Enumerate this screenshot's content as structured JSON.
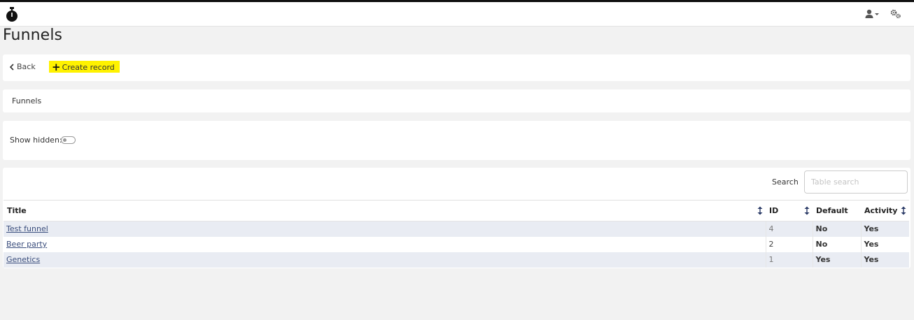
{
  "header": {
    "logo_icon": "stopwatch-icon",
    "user_icon": "user-dropdown-icon",
    "settings_icon": "gears-icon"
  },
  "page": {
    "title": "Funnels"
  },
  "toolbar": {
    "back_label": "Back",
    "create_label": "Create record",
    "create_highlight_color": "#fff200"
  },
  "breadcrumb": {
    "label": "Funnels"
  },
  "filters": {
    "show_hidden_label": "Show hidden:",
    "show_hidden": false
  },
  "search": {
    "label": "Search",
    "placeholder": "Table search",
    "value": ""
  },
  "table": {
    "columns": [
      {
        "label": "Title"
      },
      {
        "label": "ID"
      },
      {
        "label": "Default"
      },
      {
        "label": "Activity"
      }
    ],
    "rows": [
      {
        "title": "Test funnel",
        "id": "4",
        "default": "No",
        "activity": "Yes"
      },
      {
        "title": "Beer party",
        "id": "2",
        "default": "No",
        "activity": "Yes"
      },
      {
        "title": "Genetics",
        "id": "1",
        "default": "Yes",
        "activity": "Yes"
      }
    ]
  },
  "colors": {
    "yes": "#197a3e",
    "no": "#d02020",
    "link": "#3a4d7c",
    "row_stripe": "#e9ecf3"
  }
}
